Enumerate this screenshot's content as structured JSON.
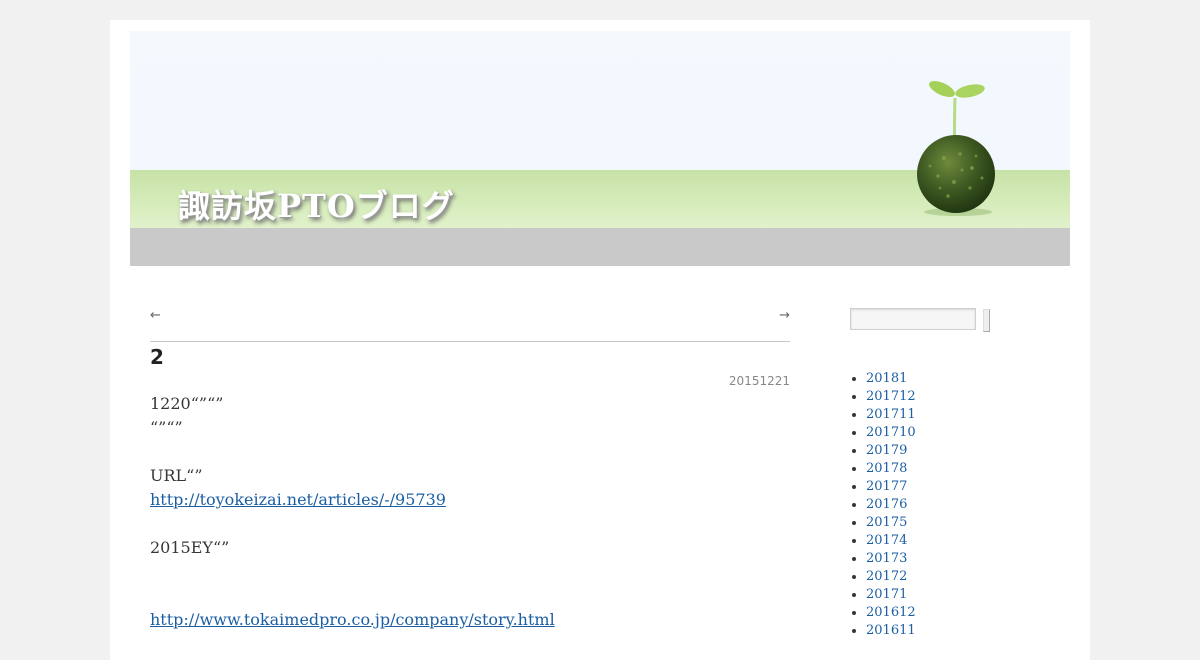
{
  "site": {
    "title": "諏訪坂PTOブログ",
    "colors": {
      "band": "#cfe7b0",
      "access_bar": "#c9c9c9",
      "link": "#1b5ea3"
    }
  },
  "nav": {
    "prev": "←",
    "next": "→"
  },
  "entry": {
    "title": "2",
    "date": "20151221",
    "paragraphs": [
      {
        "text": "1220“”“”",
        "link": false
      },
      {
        "text": "“”“”",
        "link": false
      },
      {
        "text": "",
        "link": false
      },
      {
        "text": "URL“”",
        "link": false
      },
      {
        "text": "http://toyokeizai.net/articles/-/95739",
        "link": true
      },
      {
        "text": "",
        "link": false
      },
      {
        "text": "2015EY“”",
        "link": false
      },
      {
        "text": "",
        "link": false
      },
      {
        "text": "",
        "link": false
      },
      {
        "text": "http://www.tokaimedpro.co.jp/company/story.html",
        "link": true
      }
    ]
  },
  "sidebar": {
    "search": {
      "value": "",
      "placeholder": ""
    },
    "archives": [
      "20181",
      "201712",
      "201711",
      "201710",
      "20179",
      "20178",
      "20177",
      "20176",
      "20175",
      "20174",
      "20173",
      "20172",
      "20171",
      "201612",
      "201611"
    ]
  }
}
